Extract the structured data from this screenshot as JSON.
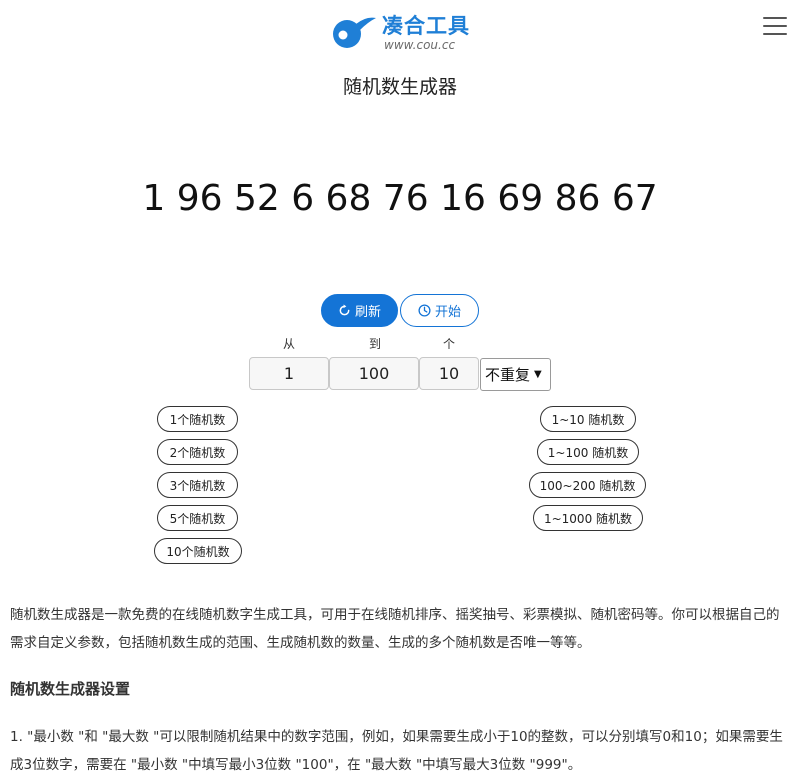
{
  "header": {
    "logo_title": "凑合工具",
    "logo_url": "www.cou.cc",
    "brand_color": "#1f7fd6"
  },
  "page_title": "随机数生成器",
  "result_numbers": "1 96 52 6 68 76 16 69 86 67",
  "actions": {
    "refresh_label": "刷新",
    "start_label": "开始",
    "refresh_icon": "refresh-icon",
    "start_icon": "clock-icon",
    "accent": "#1474d6"
  },
  "fields": {
    "from_label": "从",
    "to_label": "到",
    "count_label": "个",
    "from_value": "1",
    "to_value": "100",
    "count_value": "10",
    "mode_selected": "不重复"
  },
  "presets_left": [
    "1个随机数",
    "2个随机数",
    "3个随机数",
    "5个随机数",
    "10个随机数"
  ],
  "presets_right": [
    "1~10 随机数",
    "1~100 随机数",
    "100~200 随机数",
    "1~1000 随机数"
  ],
  "article": {
    "description": "随机数生成器是一款免费的在线随机数字生成工具，可用于在线随机排序、摇奖抽号、彩票模拟、随机密码等。你可以根据自己的需求自定义参数，包括随机数生成的范围、生成随机数的数量、生成的多个随机数是否唯一等等。",
    "section_title": "随机数生成器设置",
    "paragraph_1": "1. \"最小数 \"和 \"最大数 \"可以限制随机结果中的数字范围，例如，如果需要生成小于10的整数，可以分别填写0和10；如果需要生成3位数字，需要在 \"最小数 \"中填写最小3位数 \"100\"，在 \"最大数 \"中填写最大3位数 \"999\"。"
  }
}
